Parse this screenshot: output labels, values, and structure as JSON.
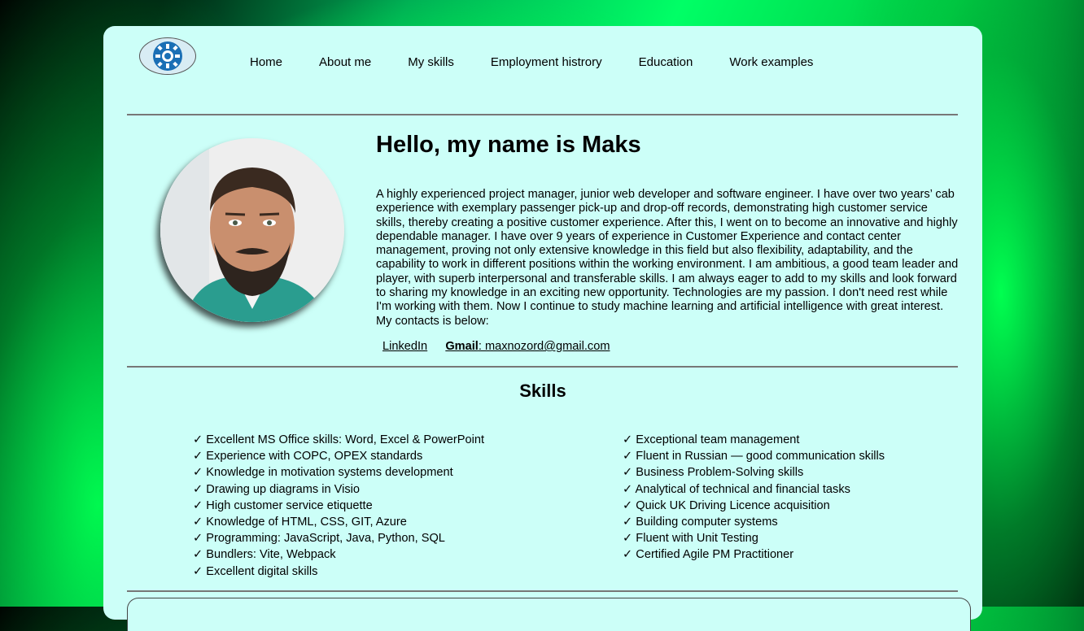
{
  "nav": {
    "items": [
      {
        "label": "Home"
      },
      {
        "label": "About me"
      },
      {
        "label": "My skills"
      },
      {
        "label": "Employment histrory"
      },
      {
        "label": "Education"
      },
      {
        "label": "Work examples"
      }
    ]
  },
  "about": {
    "title": "Hello, my name is Maks",
    "bio": "A highly experienced project manager, junior web developer and software engineer. I have over two years’ cab experience with exemplary passenger pick-up and drop-off records, demonstrating high customer service skills, thereby creating a positive customer experience. After this, I went on to become an innovative and highly dependable manager. I have over 9 years of experience in Customer Experience and contact center management, proving not only extensive knowledge in this field but also flexibility, adaptability, and the capability to work in different positions within the working environment. I am ambitious, a good team leader and player, with superb interpersonal and transferable skills. I am always eager to add to my skills and look forward to sharing my knowledge in an exciting new opportunity. Technologies are my passion. I don't need rest while I'm working with them. Now I continue to study machine learning and artificial intelligence with great interest. My contacts is below:",
    "linkedin_label": "LinkedIn",
    "gmail_label": "Gmail",
    "gmail_address": ": maxnozord@gmail.com"
  },
  "skills": {
    "title": "Skills",
    "check": "✓",
    "left": [
      "Excellent MS Office skills: Word, Excel & PowerPoint",
      "Experience with COPC, OPEX standards",
      "Knowledge in motivation systems development",
      "Drawing up diagrams in Visio",
      "High customer service etiquette",
      "Knowledge of HTML, CSS, GIT, Azure",
      "Programming: JavaScript, Java, Python, SQL",
      "Bundlers: Vite, Webpack",
      "Excellent digital skills"
    ],
    "right": [
      "Exceptional team management",
      "Fluent in Russian — good communication skills",
      "Business Problem-Solving skills",
      "Analytical of technical and financial tasks",
      "Quick UK Driving Licence acquisition",
      "Building computer systems",
      "Fluent with Unit Testing",
      "Certified Agile PM Practitioner"
    ]
  },
  "icons": {
    "logo": "gear-logo-icon",
    "photo": "profile-photo"
  },
  "colors": {
    "card_bg": "#ccfff8",
    "accent_green": "#00ff66",
    "logo_blue": "#1a6fb5"
  }
}
